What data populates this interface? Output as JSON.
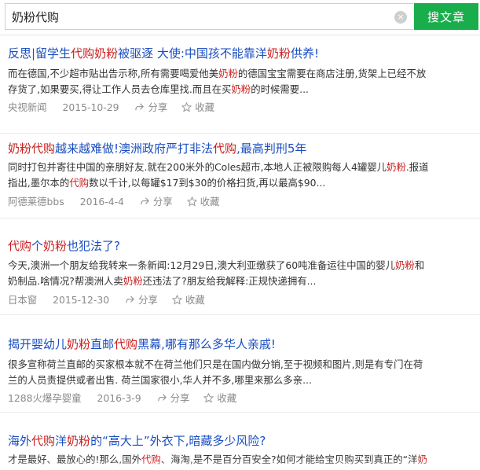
{
  "search": {
    "query": "奶粉代购",
    "button_label": "搜文章",
    "clear_glyph": "×"
  },
  "results": [
    {
      "title": [
        {
          "t": "反思|留学生"
        },
        {
          "t": "代购",
          "hl": true
        },
        {
          "t": "奶粉",
          "hl": true
        },
        {
          "t": "被驱逐 大使:中国孩不能靠洋"
        },
        {
          "t": "奶粉",
          "hl": true
        },
        {
          "t": "供养!"
        }
      ],
      "snippet_lines": [
        [
          {
            "t": "而在德国,不少超市贴出告示称,所有需要喝爱他美"
          },
          {
            "t": "奶粉",
            "hl": true
          },
          {
            "t": "的德国宝宝需要在商店注册,货架上已经不放"
          }
        ],
        [
          {
            "t": "存货了,如果要买,得让工作人员去仓库里找.而且在买"
          },
          {
            "t": "奶粉",
            "hl": true
          },
          {
            "t": "的时候需要..."
          }
        ]
      ],
      "source": "央视新闻",
      "date": "2015-10-29",
      "share": "分享",
      "fav": "收藏"
    },
    {
      "title": [
        {
          "t": "奶粉",
          "hl": true
        },
        {
          "t": "代购",
          "hl": true
        },
        {
          "t": "越来越难做!澳洲政府严打非法"
        },
        {
          "t": "代购",
          "hl": true
        },
        {
          "t": ",最高判刑5年"
        }
      ],
      "snippet_lines": [
        [
          {
            "t": "同时打包并寄往中国的亲朋好友.就在200米外的Coles超市,本地人正被限购每人4罐婴儿"
          },
          {
            "t": "奶粉",
            "hl": true
          },
          {
            "t": ".报道"
          }
        ],
        [
          {
            "t": "指出,墨尔本的"
          },
          {
            "t": "代购",
            "hl": true
          },
          {
            "t": "数以千计,以每罐$17到$30的价格扫货,再以最高$90..."
          }
        ]
      ],
      "source": "阿德莱德bbs",
      "date": "2016-4-4",
      "share": "分享",
      "fav": "收藏"
    },
    {
      "title": [
        {
          "t": "代购",
          "hl": true
        },
        {
          "t": "个"
        },
        {
          "t": "奶粉",
          "hl": true
        },
        {
          "t": "也犯法了?"
        }
      ],
      "snippet_lines": [
        [
          {
            "t": "今天,澳洲一个朋友给我转来一条新闻:12月29日,澳大利亚缴获了60吨准备运往中国的婴儿"
          },
          {
            "t": "奶粉",
            "hl": true
          },
          {
            "t": "和"
          }
        ],
        [
          {
            "t": "奶制品.啥情况?帮澳洲人卖"
          },
          {
            "t": "奶粉",
            "hl": true
          },
          {
            "t": "还违法了?朋友给我解释:正规快递拥有..."
          }
        ]
      ],
      "source": "日本窗",
      "date": "2015-12-30",
      "share": "分享",
      "fav": "收藏"
    },
    {
      "title": [
        {
          "t": "揭开婴幼儿"
        },
        {
          "t": "奶粉",
          "hl": true
        },
        {
          "t": "直邮"
        },
        {
          "t": "代购",
          "hl": true
        },
        {
          "t": "黑幕,哪有那么多华人亲戚!"
        }
      ],
      "snippet_lines": [
        [
          {
            "t": "很多宣称荷兰直邮的买家根本就不在荷兰他们只是在国内做分销,至于视频和图片,则是有专门在荷"
          }
        ],
        [
          {
            "t": "兰的人员责提供或者出售. 荷兰国家很小,华人并不多,哪里来那么多亲..."
          }
        ]
      ],
      "source": "1288火爆孕婴童",
      "date": "2016-3-9",
      "share": "分享",
      "fav": "收藏"
    },
    {
      "title": [
        {
          "t": "海外"
        },
        {
          "t": "代购",
          "hl": true
        },
        {
          "t": "洋"
        },
        {
          "t": "奶粉",
          "hl": true
        },
        {
          "t": "的“高大上”外衣下,暗藏多少风险?"
        }
      ],
      "snippet_lines": [
        [
          {
            "t": "才是最好、最放心的!那么,国外"
          },
          {
            "t": "代购",
            "hl": true
          },
          {
            "t": "、海淘,是不是百分百安全?如何才能给宝贝购买到真正的“洋"
          },
          {
            "t": "奶",
            "hl": true
          }
        ]
      ],
      "source": "",
      "date": "",
      "share": "",
      "fav": ""
    }
  ],
  "colors": {
    "title": "#1a4ec0",
    "highlight": "#c81e1e",
    "button": "#1aad4b",
    "meta": "#8a8a8a"
  }
}
